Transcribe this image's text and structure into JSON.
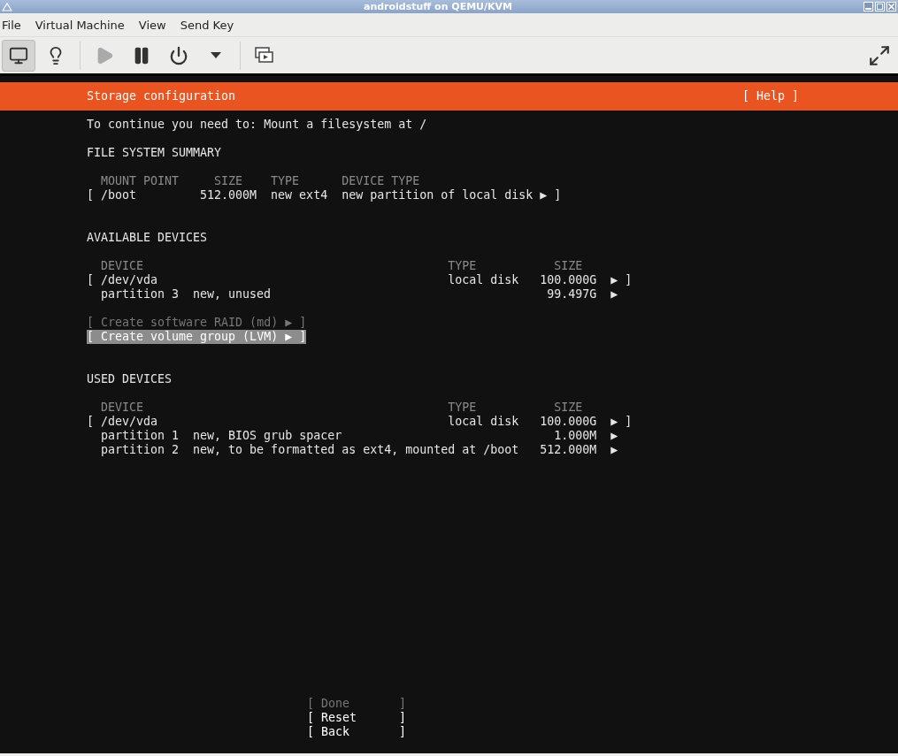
{
  "window": {
    "title": "androidstuff on QEMU/KVM"
  },
  "menu": [
    "File",
    "Virtual Machine",
    "View",
    "Send Key"
  ],
  "toolbar": {
    "view_toggles": [
      {
        "kind": "console",
        "selected": true
      },
      {
        "kind": "details",
        "selected": false
      }
    ],
    "vm_controls": [
      {
        "kind": "run",
        "disabled": true
      },
      {
        "kind": "pause",
        "disabled": false
      },
      {
        "kind": "power",
        "disabled": false
      },
      {
        "kind": "menu",
        "disabled": false
      }
    ],
    "extras": [
      {
        "kind": "snapshots"
      },
      {
        "kind": "fullscreen"
      }
    ]
  },
  "installer": {
    "header": {
      "title": "Storage configuration",
      "help": "[ Help ]"
    },
    "notice": "To continue you need to: Mount a filesystem at /",
    "fs_summary": {
      "heading": "FILE SYSTEM SUMMARY",
      "columns": [
        "MOUNT POINT",
        "SIZE",
        "TYPE",
        "DEVICE TYPE"
      ],
      "rows": [
        {
          "open": "[",
          "mount_point": "/boot",
          "size": "512.000M",
          "type": "new ext4",
          "device_type": "new partition of local disk",
          "marker": "▶",
          "close": "]"
        }
      ]
    },
    "available_devices": {
      "heading": "AVAILABLE DEVICES",
      "columns": [
        "DEVICE",
        "TYPE",
        "SIZE"
      ],
      "devices": [
        {
          "open": "[",
          "device": "/dev/vda",
          "type": "local disk",
          "size": "100.000G",
          "marker": "▶",
          "close": "]",
          "children": [
            {
              "name": "partition 3",
              "description": "new, unused",
              "size": "99.497G",
              "marker": "▶"
            }
          ]
        }
      ],
      "actions": [
        {
          "label": "[ Create software RAID (md) ▶ ]",
          "disabled": true,
          "selected": false
        },
        {
          "label": "[ Create volume group (LVM) ▶ ]",
          "disabled": false,
          "selected": true
        }
      ]
    },
    "used_devices": {
      "heading": "USED DEVICES",
      "columns": [
        "DEVICE",
        "TYPE",
        "SIZE"
      ],
      "devices": [
        {
          "open": "[",
          "device": "/dev/vda",
          "type": "local disk",
          "size": "100.000G",
          "marker": "▶",
          "close": "]",
          "children": [
            {
              "name": "partition 1",
              "description": "new, BIOS grub spacer",
              "size": "1.000M",
              "marker": "▶"
            },
            {
              "name": "partition 2",
              "description": "new, to be formatted as ext4, mounted at /boot",
              "size": "512.000M",
              "marker": "▶"
            }
          ]
        }
      ]
    },
    "buttons": [
      {
        "label": "[ Done       ]",
        "disabled": true
      },
      {
        "label": "[ Reset      ]",
        "disabled": false
      },
      {
        "label": "[ Back       ]",
        "disabled": false
      }
    ]
  }
}
